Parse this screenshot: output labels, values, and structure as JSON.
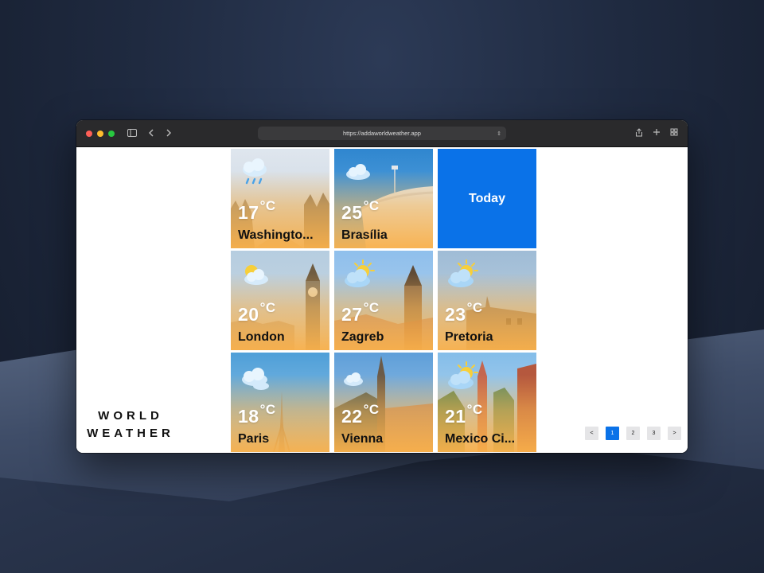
{
  "browser": {
    "url": "https://addaworldweather.app"
  },
  "brand": {
    "line1": "WORLD",
    "line2": "WEATHER"
  },
  "today_tile": {
    "label": "Today"
  },
  "cities": [
    {
      "name": "Washingto...",
      "temp": "17",
      "unit": "°C",
      "condition": "rain",
      "sky": "#cfd9e4"
    },
    {
      "name": "Brasília",
      "temp": "25",
      "unit": "°C",
      "condition": "cloudy",
      "sky": "#3d8fd1"
    },
    {
      "name": "London",
      "temp": "20",
      "unit": "°C",
      "condition": "partly-cloudy",
      "sky": "#b9cfe0"
    },
    {
      "name": "Zagreb",
      "temp": "27",
      "unit": "°C",
      "condition": "partly-sunny",
      "sky": "#9ec6ec"
    },
    {
      "name": "Pretoria",
      "temp": "23",
      "unit": "°C",
      "condition": "partly-sunny",
      "sky": "#a9c4dc"
    },
    {
      "name": "Paris",
      "temp": "18",
      "unit": "°C",
      "condition": "cloudy",
      "sky": "#5aa8dc"
    },
    {
      "name": "Vienna",
      "temp": "22",
      "unit": "°C",
      "condition": "cloudy",
      "sky": "#6ea9dd"
    },
    {
      "name": "Mexico Ci...",
      "temp": "21",
      "unit": "°C",
      "condition": "partly-sunny",
      "sky": "#8fc1e9"
    }
  ],
  "pagination": {
    "prev": "<",
    "pages": [
      "1",
      "2",
      "3"
    ],
    "active": "1",
    "next": ">"
  },
  "colors": {
    "accent": "#0a72e8",
    "tile_gradient": "#f9b04a"
  }
}
